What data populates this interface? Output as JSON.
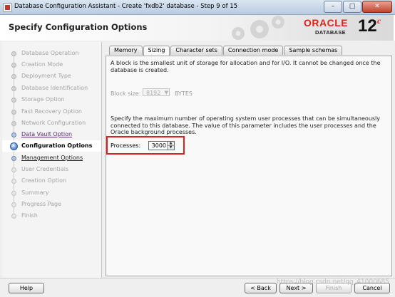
{
  "window": {
    "title": "Database Configuration Assistant - Create 'fxdb2' database - Step 9 of 15",
    "minimize": "–",
    "maximize": "□",
    "close": "✕"
  },
  "header": {
    "page_title": "Specify Configuration Options",
    "logo_oracle": "ORACLE",
    "logo_database": "DATABASE",
    "logo_version": "12",
    "logo_version_sup": "c"
  },
  "sidebar": {
    "steps": [
      {
        "label": "Database Operation"
      },
      {
        "label": "Creation Mode"
      },
      {
        "label": "Deployment Type"
      },
      {
        "label": "Database Identification"
      },
      {
        "label": "Storage Option"
      },
      {
        "label": "Fast Recovery Option"
      },
      {
        "label": "Network Configuration"
      },
      {
        "label": "Data Vault Option"
      },
      {
        "label": "Configuration Options"
      },
      {
        "label": "Management Options"
      },
      {
        "label": "User Credentials"
      },
      {
        "label": "Creation Option"
      },
      {
        "label": "Summary"
      },
      {
        "label": "Progress Page"
      },
      {
        "label": "Finish"
      }
    ]
  },
  "tabs": [
    "Memory",
    "Sizing",
    "Character sets",
    "Connection mode",
    "Sample schemas"
  ],
  "sizing": {
    "block_intro": "A block is the smallest unit of storage for allocation and for I/O. It cannot be changed once the database is created.",
    "block_size_label": "Block size:",
    "block_size_value": "8192",
    "block_size_unit": "BYTES",
    "processes_intro": "Specify the maximum number of operating system user processes that can be simultaneously connected to this database. The value of this parameter includes the user processes and the Oracle background processes.",
    "processes_label": "Processes:",
    "processes_value": "3000"
  },
  "footer": {
    "help": "Help",
    "back": "< Back",
    "next": "Next >",
    "finish": "Finish",
    "cancel": "Cancel",
    "watermark": "https://blog.csdn.net/qq_41000685"
  },
  "colors": {
    "oracle_red": "#e2211c",
    "highlight_red": "#e02020",
    "current_step_blue": "#2d63b2"
  }
}
